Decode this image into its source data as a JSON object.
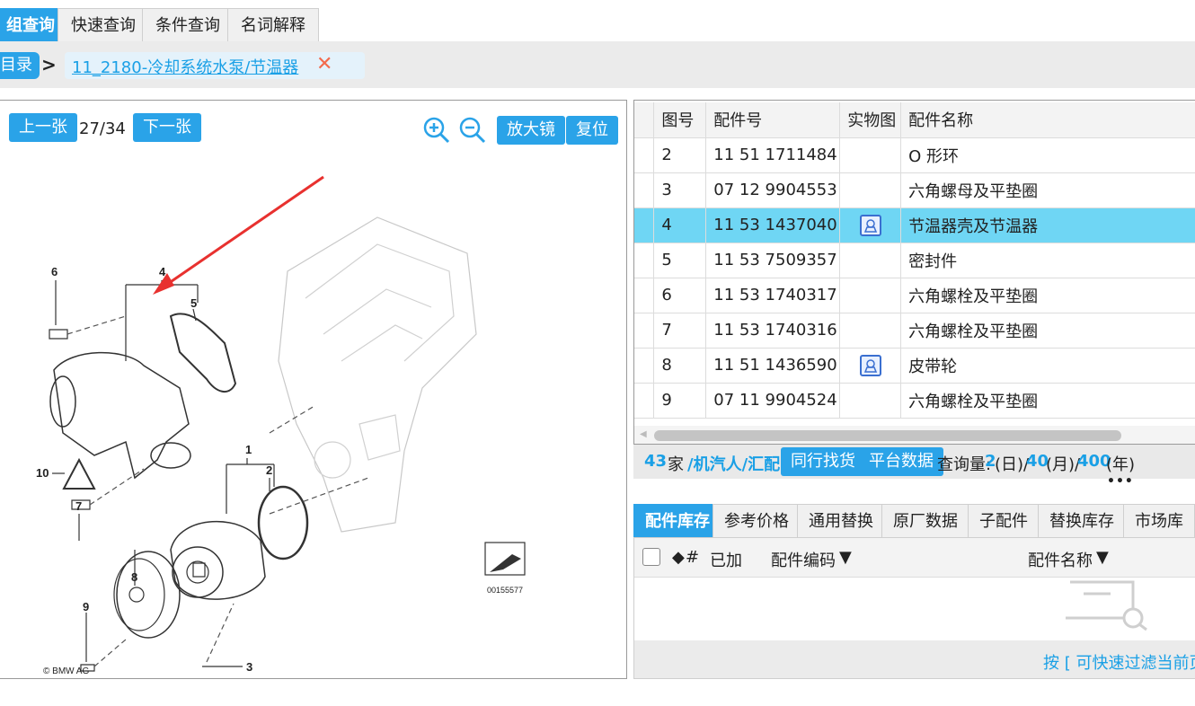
{
  "top_tabs": [
    "组查询",
    "快速查询",
    "条件查询",
    "名词解释"
  ],
  "breadcrumb": {
    "root": "目录",
    "item": "11_2180-冷却系统水泵/节温器",
    "close_icon": "close-icon"
  },
  "image_viewer": {
    "prev_label": "上一张",
    "page_indicator": "27/34",
    "next_label": "下一张",
    "magnifier_label": "放大镜",
    "reset_label": "复位",
    "diagram_code": "00155577",
    "copyright": "© BMW AG"
  },
  "parts_table": {
    "headers": [
      "图号",
      "配件号",
      "实物图",
      "配件名称"
    ],
    "rows": [
      {
        "no": "2",
        "part": "11 51 1711484",
        "pic": false,
        "name": "O 形环"
      },
      {
        "no": "3",
        "part": "07 12 9904553",
        "pic": false,
        "name": "六角螺母及平垫圈"
      },
      {
        "no": "4",
        "part": "11 53 1437040",
        "pic": true,
        "name": "节温器壳及节温器",
        "selected": true
      },
      {
        "no": "5",
        "part": "11 53 7509357",
        "pic": false,
        "name": "密封件"
      },
      {
        "no": "6",
        "part": "11 53 1740317",
        "pic": false,
        "name": "六角螺栓及平垫圈"
      },
      {
        "no": "7",
        "part": "11 53 1740316",
        "pic": false,
        "name": "六角螺栓及平垫圈"
      },
      {
        "no": "8",
        "part": "11 51 1436590",
        "pic": true,
        "name": "皮带轮"
      },
      {
        "no": "9",
        "part": "07 11 9904524",
        "pic": false,
        "name": "六角螺栓及平垫圈"
      }
    ]
  },
  "status": {
    "count": "43",
    "unit": "家",
    "sources": "/机汽人/汇配",
    "btn_peer": "同行找货",
    "btn_platform": "平台数据",
    "query_label": "查询量:",
    "day_val": "2",
    "day_unit": "(日)/",
    "month_val": "40",
    "month_unit": "(月)/",
    "year_val": "400",
    "year_unit": "(年)",
    "more": "•••"
  },
  "bottom_tabs": [
    "配件库存",
    "参考价格",
    "通用替换",
    "原厂数据",
    "子配件",
    "替换库存",
    "市场库存"
  ],
  "stock_table": {
    "col_hash": "#",
    "col_added": "已加",
    "col_code": "配件编码",
    "col_name": "配件名称",
    "hint": "按 [ 可快速过滤当前页"
  },
  "colors": {
    "accent": "#2aa3e8",
    "selected_row": "#6fd6f4",
    "close": "#f36a4c"
  }
}
